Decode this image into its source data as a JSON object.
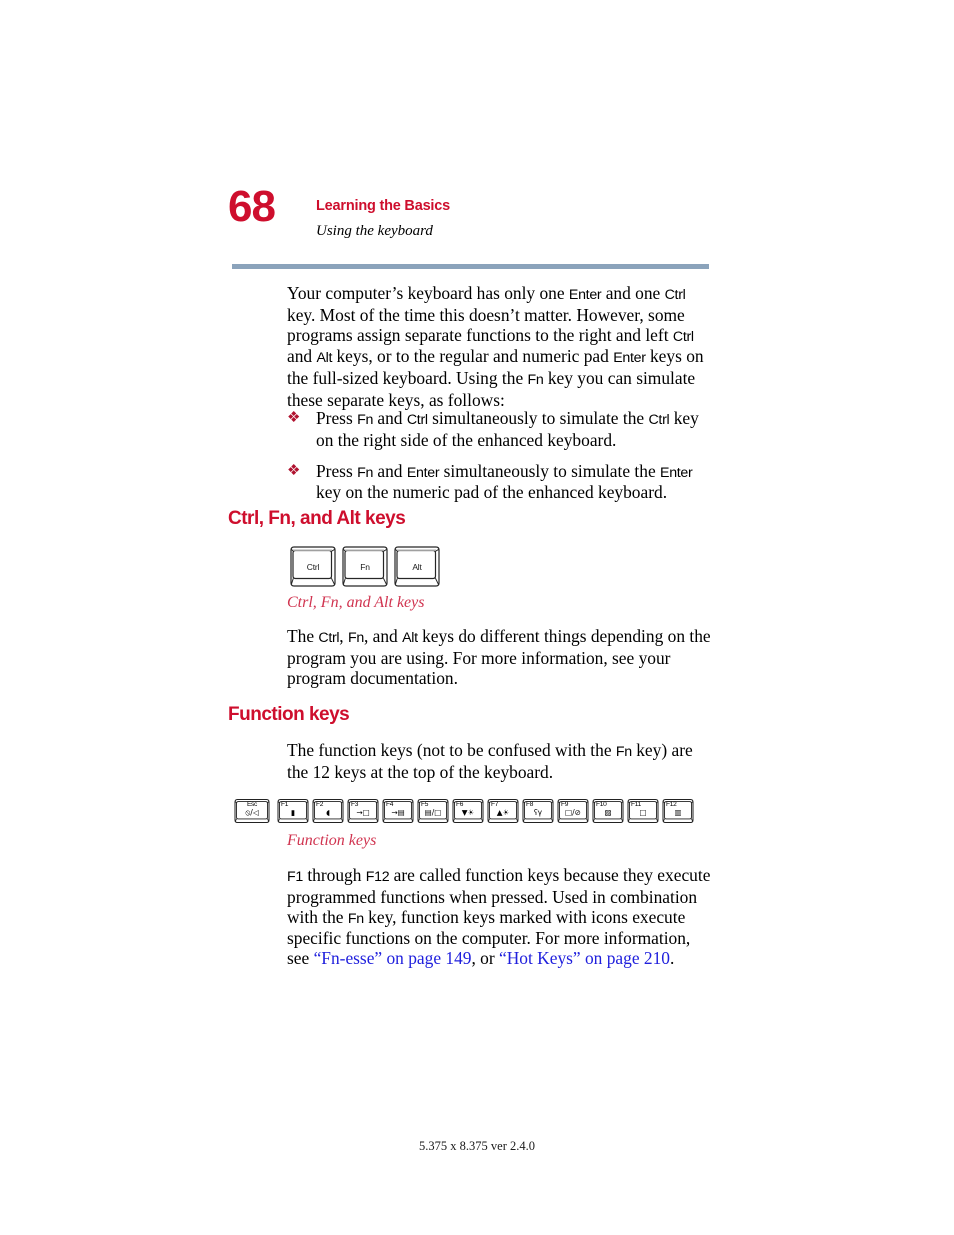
{
  "page": {
    "number": "68",
    "chapter": "Learning the Basics",
    "section": "Using the keyboard",
    "footer": "5.375 x 8.375 ver 2.4.0",
    "rule_color": "#8ba3bb",
    "accent_color": "#ce0e2d",
    "link_color": "#2020dd",
    "caption_color": "#d0334f"
  },
  "intro": {
    "p1_a": "Your computer’s keyboard has only one ",
    "p1_k1": "Enter",
    "p1_b": " and one ",
    "p1_k2": "Ctrl",
    "p1_c": " key. Most of the time this doesn’t matter. However, some programs assign separate functions to the right and left ",
    "p1_k3": "Ctrl",
    "p1_d": " and ",
    "p1_k4": "Alt",
    "p1_e": " keys, or to the regular and numeric pad ",
    "p1_k5": "Enter",
    "p1_f": " keys on the full-sized keyboard. Using the ",
    "p1_k6": "Fn",
    "p1_g": " key you can simulate these separate keys, as follows:"
  },
  "bullets": {
    "mark": "❖",
    "items": [
      {
        "a": "Press ",
        "k1": "Fn",
        "b": " and ",
        "k2": "Ctrl",
        "c": " simultaneously to simulate the ",
        "k3": "Ctrl",
        "d": " key on the right side of the enhanced keyboard."
      },
      {
        "a": "Press ",
        "k1": "Fn",
        "b": " and ",
        "k2": "Enter",
        "c": " simultaneously to simulate the ",
        "k3": "Enter",
        "d": " key on the numeric pad of the enhanced keyboard."
      }
    ]
  },
  "section_ctrl": {
    "heading": "Ctrl, Fn, and Alt keys",
    "caption": "Ctrl, Fn, and Alt keys",
    "keys": [
      {
        "label": "Ctrl"
      },
      {
        "label": "Fn"
      },
      {
        "label": "Alt"
      }
    ],
    "p_a": "The ",
    "p_k1": "Ctrl",
    "p_b": ", ",
    "p_k2": "Fn",
    "p_c": ", and ",
    "p_k3": "Alt",
    "p_d": " keys do different things depending on the program you are using. For more information, see your program documentation."
  },
  "section_function": {
    "heading": "Function keys",
    "caption": "Function keys",
    "p_intro_a": "The function keys (not to be confused with the ",
    "p_intro_k": "Fn",
    "p_intro_b": " key) are the 12 keys at the top of the keyboard.",
    "keys": [
      {
        "name": "Esc",
        "glyph": "⦸/◁",
        "icon": "mute-icon"
      },
      {
        "name": "F1",
        "glyph": "▮",
        "icon": "lock-icon"
      },
      {
        "name": "F2",
        "glyph": "◖",
        "icon": "power-mode-icon"
      },
      {
        "name": "F3",
        "glyph": "→□",
        "icon": "standby-icon"
      },
      {
        "name": "F4",
        "glyph": "→▤",
        "icon": "hibernate-icon"
      },
      {
        "name": "F5",
        "glyph": "▤/□",
        "icon": "display-switch-icon"
      },
      {
        "name": "F6",
        "glyph": "▼☀",
        "icon": "brightness-down-icon"
      },
      {
        "name": "F7",
        "glyph": "▲☀",
        "icon": "brightness-up-icon"
      },
      {
        "name": "F8",
        "glyph": "ʕγ",
        "icon": "wireless-icon"
      },
      {
        "name": "F9",
        "glyph": "□/⊘",
        "icon": "touchpad-icon"
      },
      {
        "name": "F10",
        "glyph": "▨",
        "icon": "cursor-keypad-icon"
      },
      {
        "name": "F11",
        "glyph": "□",
        "icon": "numeric-keypad-icon"
      },
      {
        "name": "F12",
        "glyph": "▥",
        "icon": "scroll-lock-icon"
      }
    ],
    "p_a": "",
    "p_k1": "F1",
    "p_b": " through ",
    "p_k2": "F12",
    "p_c": " are called function keys because they execute programmed functions when pressed. Used in combination with the ",
    "p_k3": "Fn",
    "p_d": " key, function keys marked with icons execute specific functions on the computer. For more information, see ",
    "link1": "“Fn-esse” on page 149",
    "p_e": ", or ",
    "link2": "“Hot Keys” on page 210",
    "p_f": "."
  }
}
